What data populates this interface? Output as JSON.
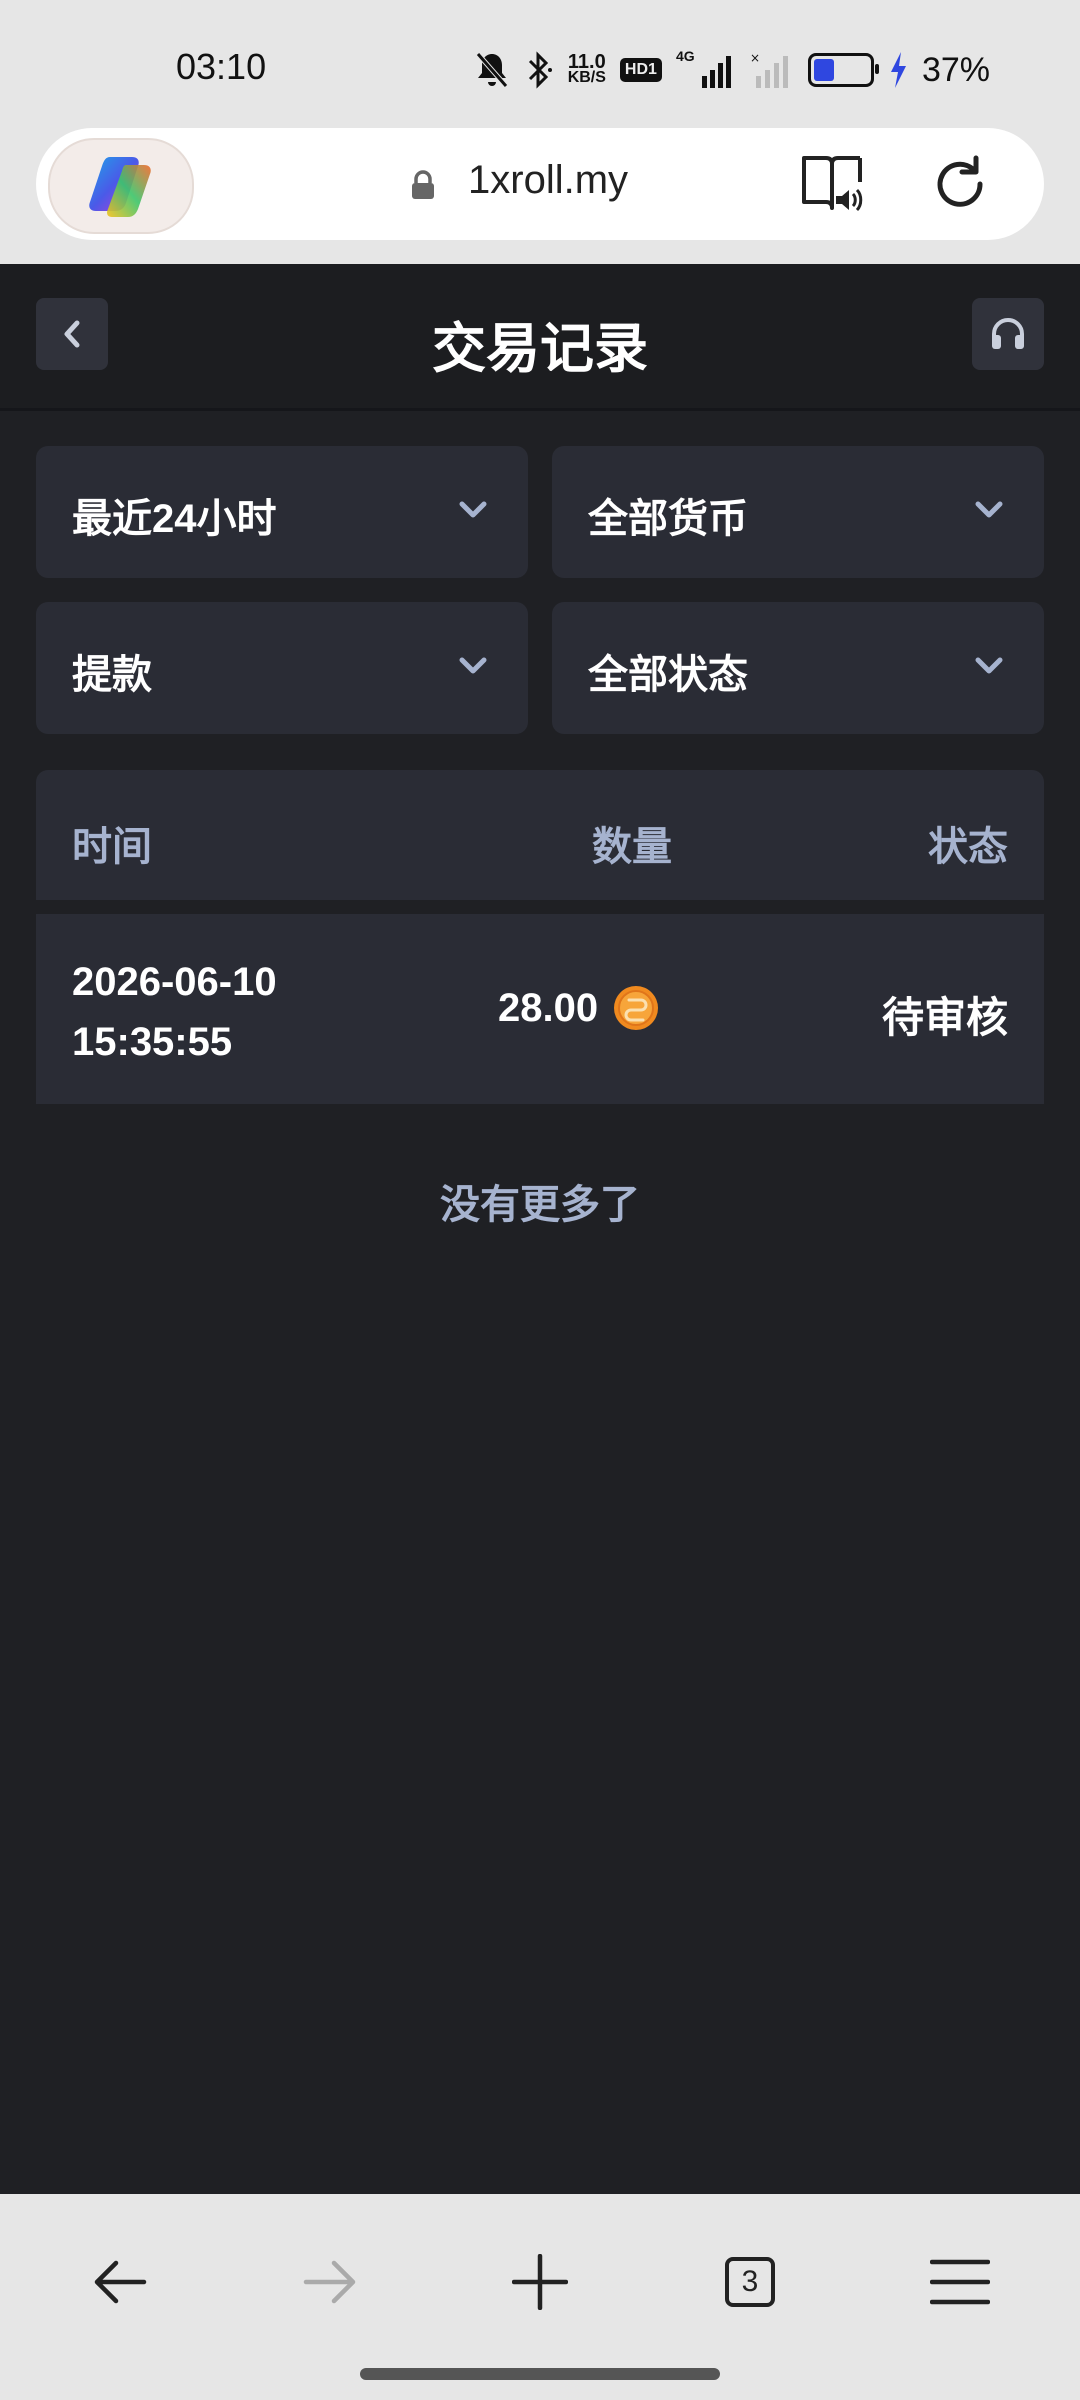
{
  "status_bar": {
    "time": "03:10",
    "net_speed_value": "11.0",
    "net_speed_unit": "KB/S",
    "hd_badge": "HD1",
    "network_type": "4G",
    "battery_percent_text": "37%",
    "battery_level": 0.37,
    "icons": [
      "mute-bell-icon",
      "bluetooth-icon",
      "signal-icon",
      "signal-empty-icon",
      "battery-icon",
      "charging-icon"
    ]
  },
  "browser": {
    "url": "1xroll.my",
    "icons": [
      "copilot-icon",
      "lock-icon",
      "reader-mode-icon",
      "reload-icon"
    ]
  },
  "header": {
    "title": "交易记录",
    "back_icon": "chevron-left-icon",
    "support_icon": "headphones-icon"
  },
  "filters": {
    "time_range": "最近24小时",
    "currency": "全部货币",
    "type": "提款",
    "status": "全部状态"
  },
  "table": {
    "columns": [
      "时间",
      "数量",
      "状态"
    ],
    "rows": [
      {
        "date": "2026-06-10",
        "time": "15:35:55",
        "amount": "28.00",
        "status": "待审核"
      }
    ],
    "no_more_text": "没有更多了"
  },
  "bottom_nav": {
    "tab_count": "3",
    "icons": [
      "back-arrow-icon",
      "forward-arrow-icon",
      "new-tab-plus-icon",
      "tabs-icon",
      "menu-icon"
    ]
  },
  "colors": {
    "page_bg": "#1f2024",
    "card_bg": "#2a2c35",
    "muted_text": "#a6b3cf",
    "battery_fill": "#2f47e0",
    "charging": "#2f47e0"
  }
}
